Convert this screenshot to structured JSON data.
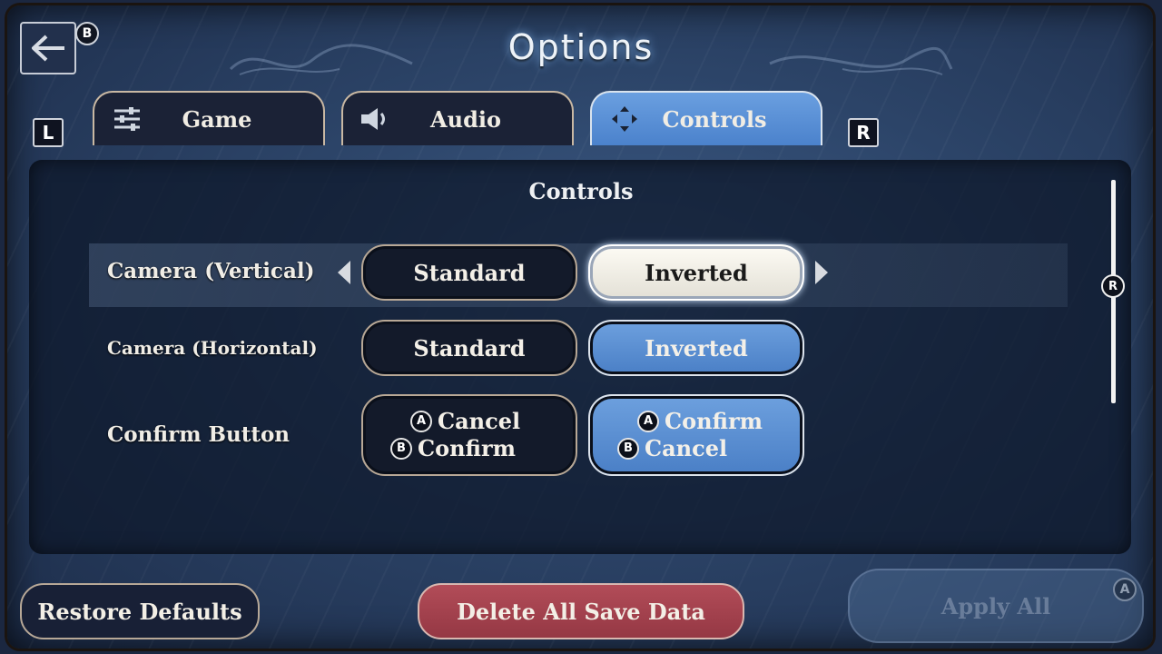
{
  "header": {
    "title": "Options",
    "back_glyph": "B"
  },
  "tabs": [
    {
      "label": "Game",
      "icon": "sliders-icon",
      "active": false
    },
    {
      "label": "Audio",
      "icon": "speaker-icon",
      "active": false
    },
    {
      "label": "Controls",
      "icon": "dpad-icon",
      "active": true
    }
  ],
  "shoulders": {
    "left": "L",
    "right": "R"
  },
  "panel": {
    "title": "Controls",
    "rows": [
      {
        "label": "Camera (Vertical)",
        "options": [
          "Standard",
          "Inverted"
        ],
        "selected": "Inverted"
      },
      {
        "label": "Camera (Horizontal)",
        "options": [
          "Standard",
          "Inverted"
        ],
        "selected": "Inverted"
      },
      {
        "label": "Confirm Button",
        "option_a": {
          "line1_glyph": "A",
          "line1_text": "Cancel",
          "line2_glyph": "B",
          "line2_text": "Confirm"
        },
        "option_b": {
          "line1_glyph": "A",
          "line1_text": "Confirm",
          "line2_glyph": "B",
          "line2_text": "Cancel"
        },
        "selected": "option_b"
      }
    ],
    "scroll_glyph": "R"
  },
  "footer": {
    "restore_label": "Restore Defaults",
    "delete_label": "Delete All Save Data",
    "apply_label": "Apply All",
    "apply_glyph": "A"
  },
  "colors": {
    "background": "#2c4468",
    "selected_blue": "#5a8fd6",
    "focus_white": "#f6f3ea",
    "danger_red": "#a5424e"
  }
}
